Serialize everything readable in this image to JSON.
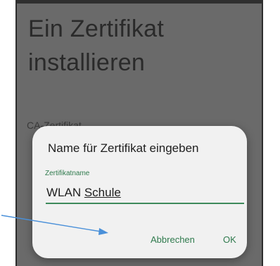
{
  "page": {
    "title_line1": "Ein Zertifikat",
    "title_line2": "installieren"
  },
  "background": {
    "section_label": "CA-Zertifikat"
  },
  "dialog": {
    "title": "Name für Zertifikat eingeben",
    "field_label": "Zertifikatname",
    "field_value_part1": "WLAN ",
    "field_value_part2": "Schule",
    "cancel_label": "Abbrechen",
    "ok_label": "OK"
  },
  "colors": {
    "accent": "#2f7a4d",
    "overlay": "#6a6a6a",
    "arrow": "#4a90d9"
  }
}
